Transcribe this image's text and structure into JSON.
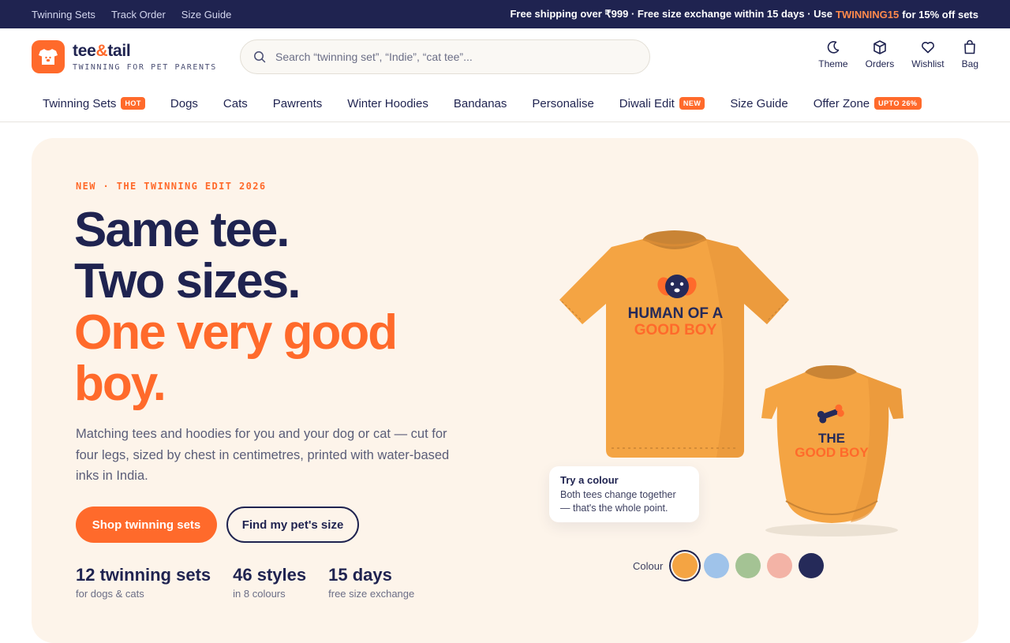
{
  "topbar": {
    "links": [
      "Twinning Sets",
      "Track Order",
      "Size Guide"
    ],
    "promo_before": "Free shipping over ₹999 · Free size exchange within 15 days · Use",
    "promo_code": "TWINNING15",
    "promo_after": "for 15% off sets"
  },
  "brand": {
    "name_part1": "tee",
    "name_amp": "&",
    "name_part2": "tail",
    "tagline": "TWINNING FOR PET PARENTS"
  },
  "search": {
    "placeholder": "Search “twinning set”, “Indie”, “cat tee”..."
  },
  "header_actions": [
    {
      "label": "Theme",
      "icon": "moon-icon"
    },
    {
      "label": "Orders",
      "icon": "box-icon"
    },
    {
      "label": "Wishlist",
      "icon": "heart-icon"
    },
    {
      "label": "Bag",
      "icon": "bag-icon"
    }
  ],
  "nav": [
    {
      "label": "Twinning Sets",
      "badge": "HOT"
    },
    {
      "label": "Dogs"
    },
    {
      "label": "Cats"
    },
    {
      "label": "Pawrents"
    },
    {
      "label": "Winter Hoodies"
    },
    {
      "label": "Bandanas"
    },
    {
      "label": "Personalise"
    },
    {
      "label": "Diwali Edit",
      "badge": "NEW"
    },
    {
      "label": "Size Guide"
    },
    {
      "label": "Offer Zone",
      "badge": "UPTO 26%"
    }
  ],
  "hero": {
    "eyebrow": "NEW · THE TWINNING EDIT 2026",
    "headline_1": "Same tee.",
    "headline_2": "Two sizes.",
    "headline_3": "One very good boy.",
    "subtext": "Matching tees and hoodies for you and your dog or cat — cut for four legs, sized by chest in centimetres, printed with water-based inks in India.",
    "primary_cta": "Shop twinning sets",
    "secondary_cta": "Find my pet's size",
    "stats": [
      {
        "value": "12 twinning sets",
        "label": "for dogs & cats"
      },
      {
        "value": "46 styles",
        "label": "in 8 colours"
      },
      {
        "value": "15 days",
        "label": "free size exchange"
      }
    ],
    "human_tee_text_1": "HUMAN OF A",
    "human_tee_text_2": "GOOD BOY",
    "pet_tee_text_1": "THE",
    "pet_tee_text_2": "GOOD BOY",
    "tooltip_title": "Try a colour",
    "tooltip_body": "Both tees change together — that's the whole point.",
    "colour_label": "Colour",
    "colours": [
      "#f4a443",
      "#9fc3ea",
      "#a4c394",
      "#f3b3a6",
      "#252a59"
    ],
    "selected_colour": "#f4a443"
  },
  "colors": {
    "navy": "#1f2350",
    "accent": "#ff6a2b",
    "hero_bg": "#fdf4ea"
  }
}
